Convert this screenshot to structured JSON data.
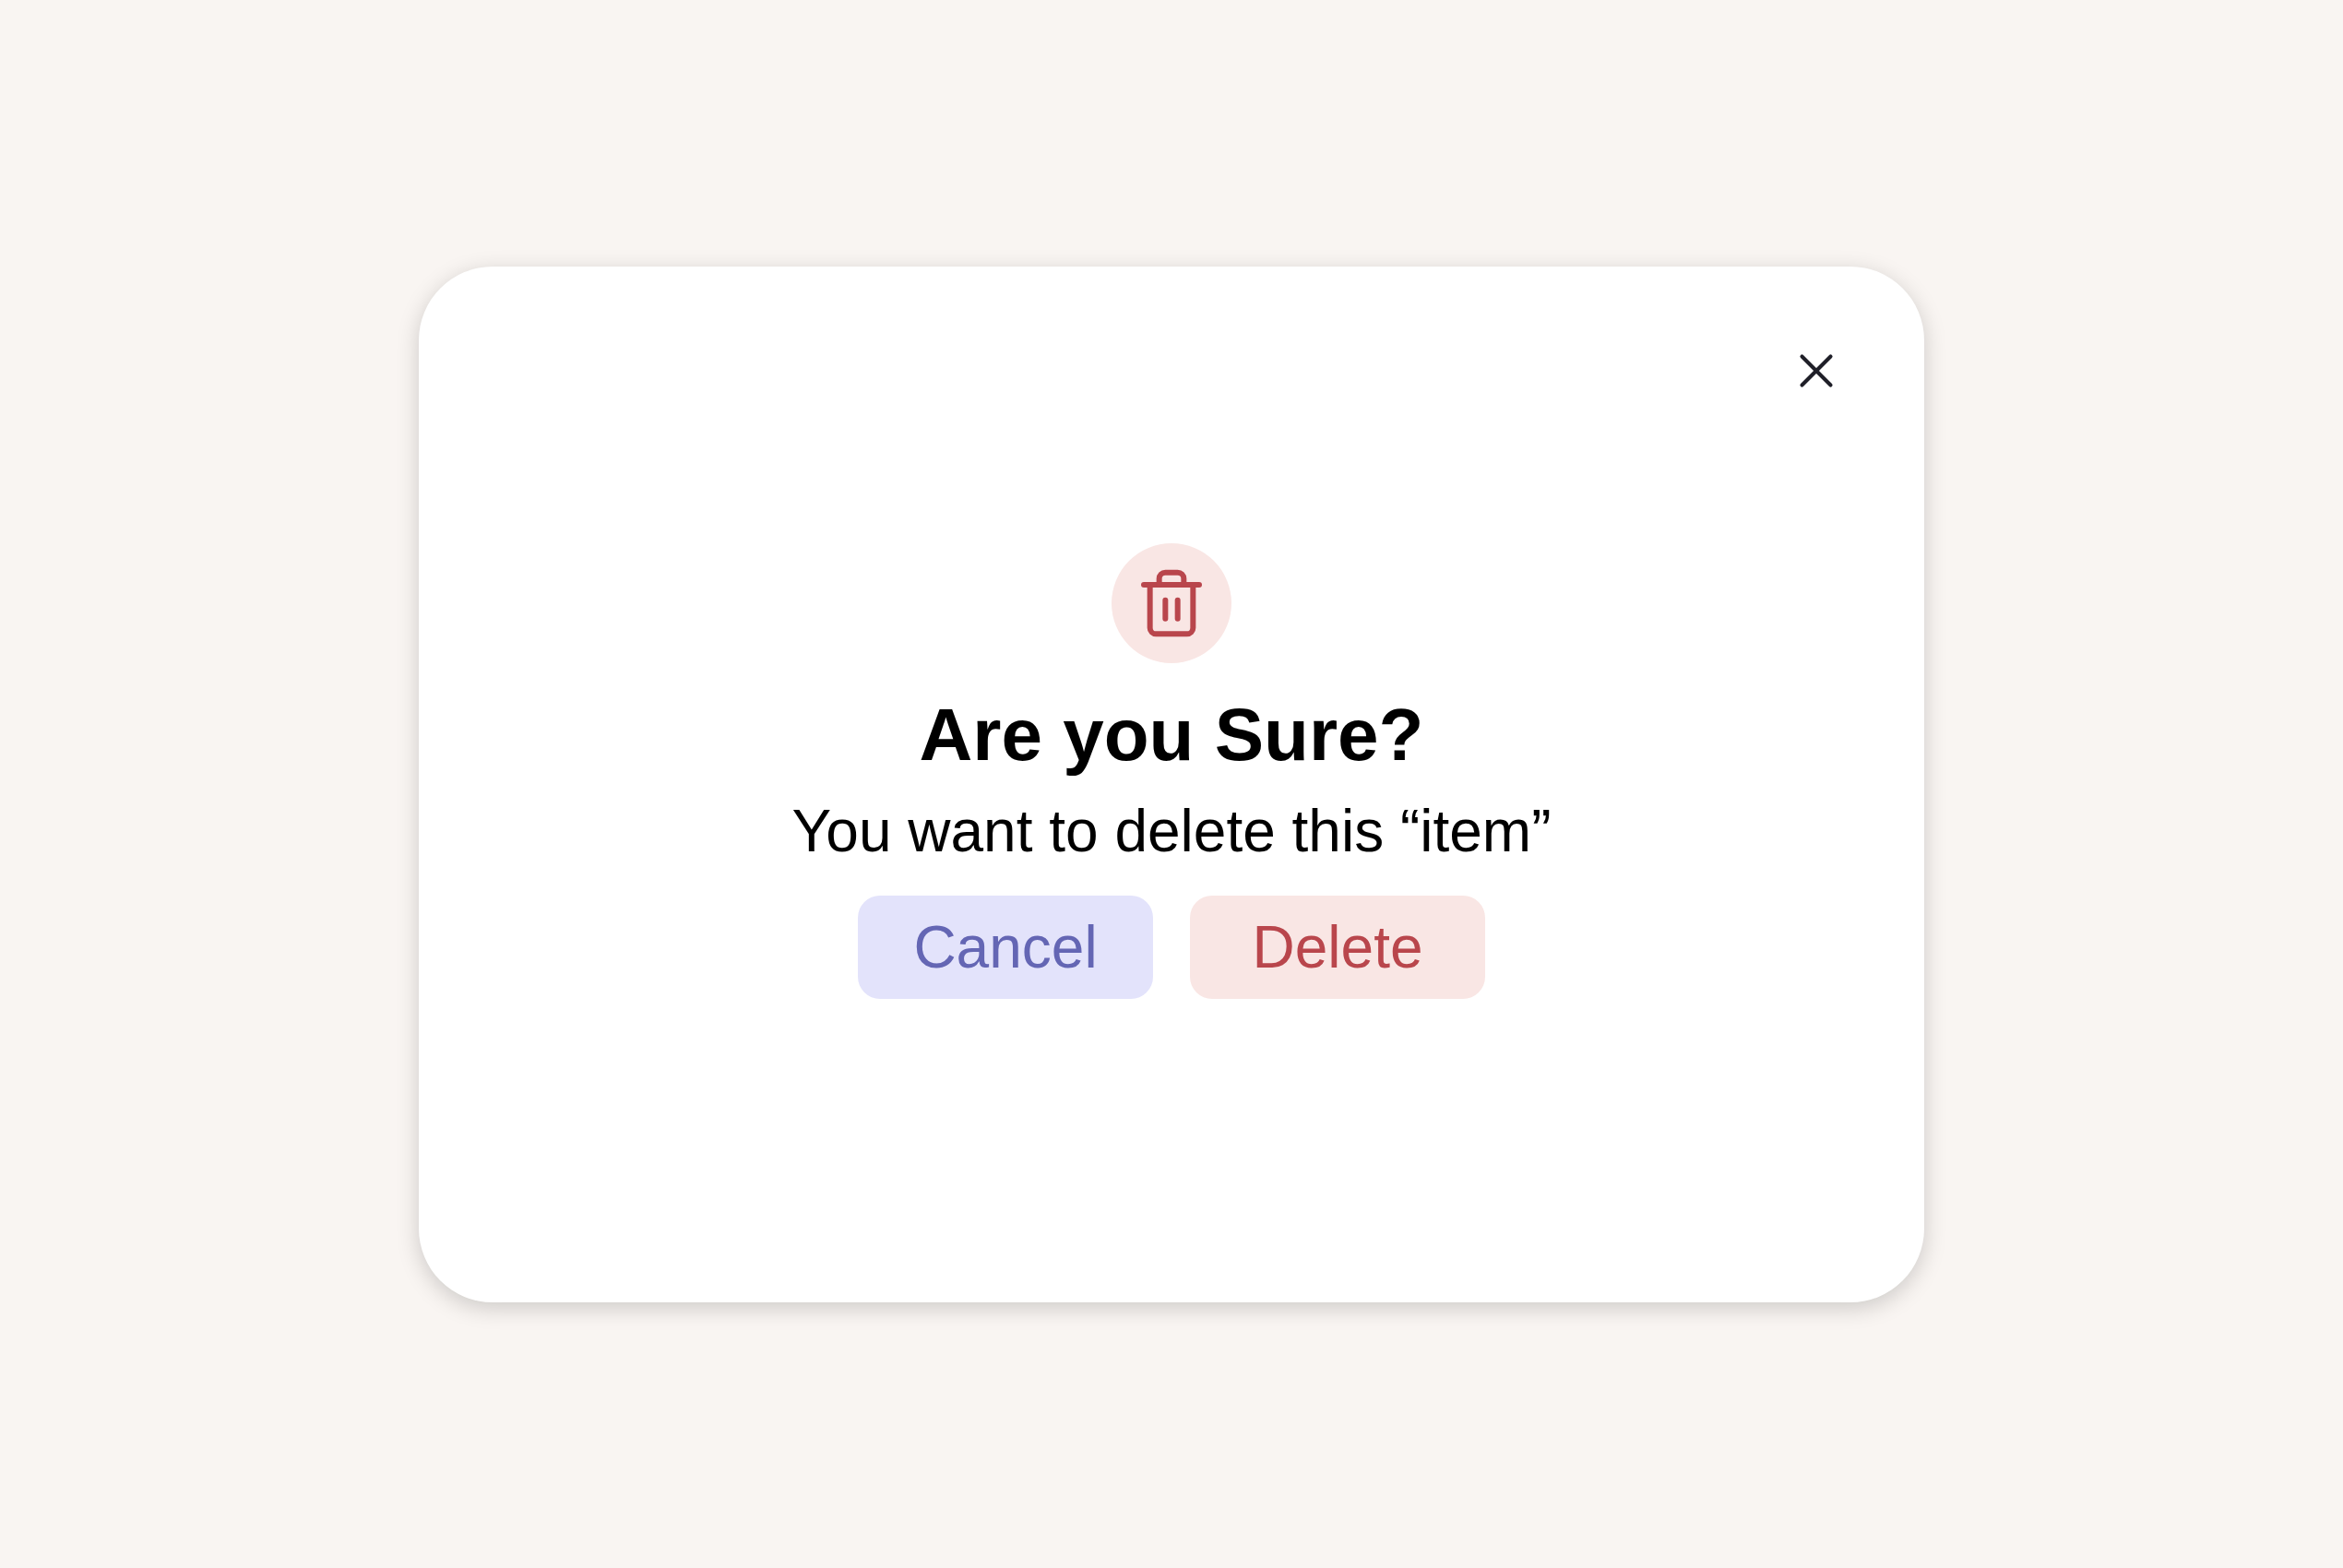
{
  "dialog": {
    "title": "Are you Sure?",
    "message": "You want to delete this “item”",
    "buttons": [
      {
        "label": "Cancel",
        "kind": "cancel"
      },
      {
        "label": "Delete",
        "kind": "danger"
      }
    ]
  }
}
